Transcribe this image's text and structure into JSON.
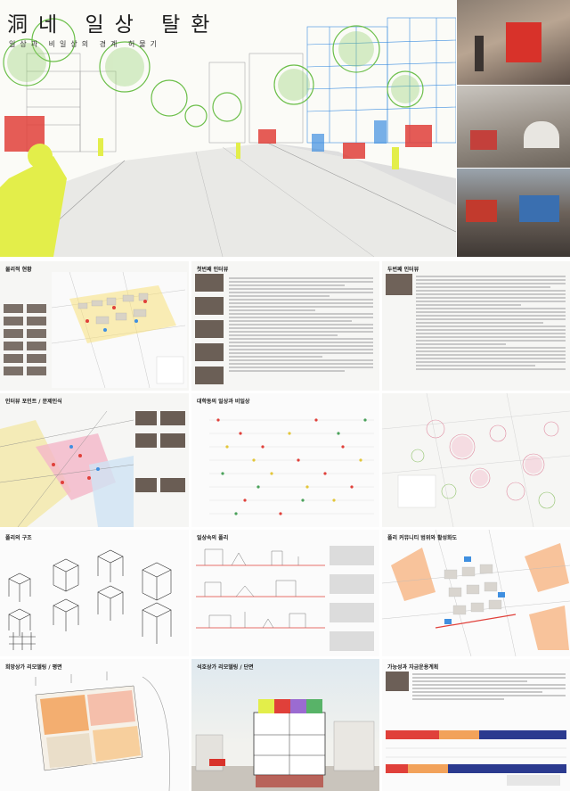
{
  "header": {
    "title": "洞네 일상 탈환",
    "subtitle": "일상과 비일상의 경계 허물기"
  },
  "panels": {
    "physical_status": "물리적 현황",
    "first_interview": "첫번째 인터뷰",
    "second_interview": "두번째 인터뷰",
    "interview_points": "인터뷰 포인트 / 문제인식",
    "daily_nondaily": "대학동의 일상과 비일상",
    "folly_structure": "폴리의 구조",
    "daily_folly": "일상속의 폴리",
    "community_range": "폴리 커뮤니티 범위와 활성화도",
    "shop_remodel_plan": "희망상가 리모델링 / 평면",
    "shop_remodel_section": "석호상가 리모델링 / 단면",
    "funding_plan": "가능성과 자금운용계획"
  },
  "colors": {
    "accent_yellow": "#e3ee4a",
    "accent_red": "#e0403a",
    "accent_blue": "#3f8fe0",
    "accent_pink": "#f4b6c8",
    "accent_orange": "#f2a25a"
  }
}
